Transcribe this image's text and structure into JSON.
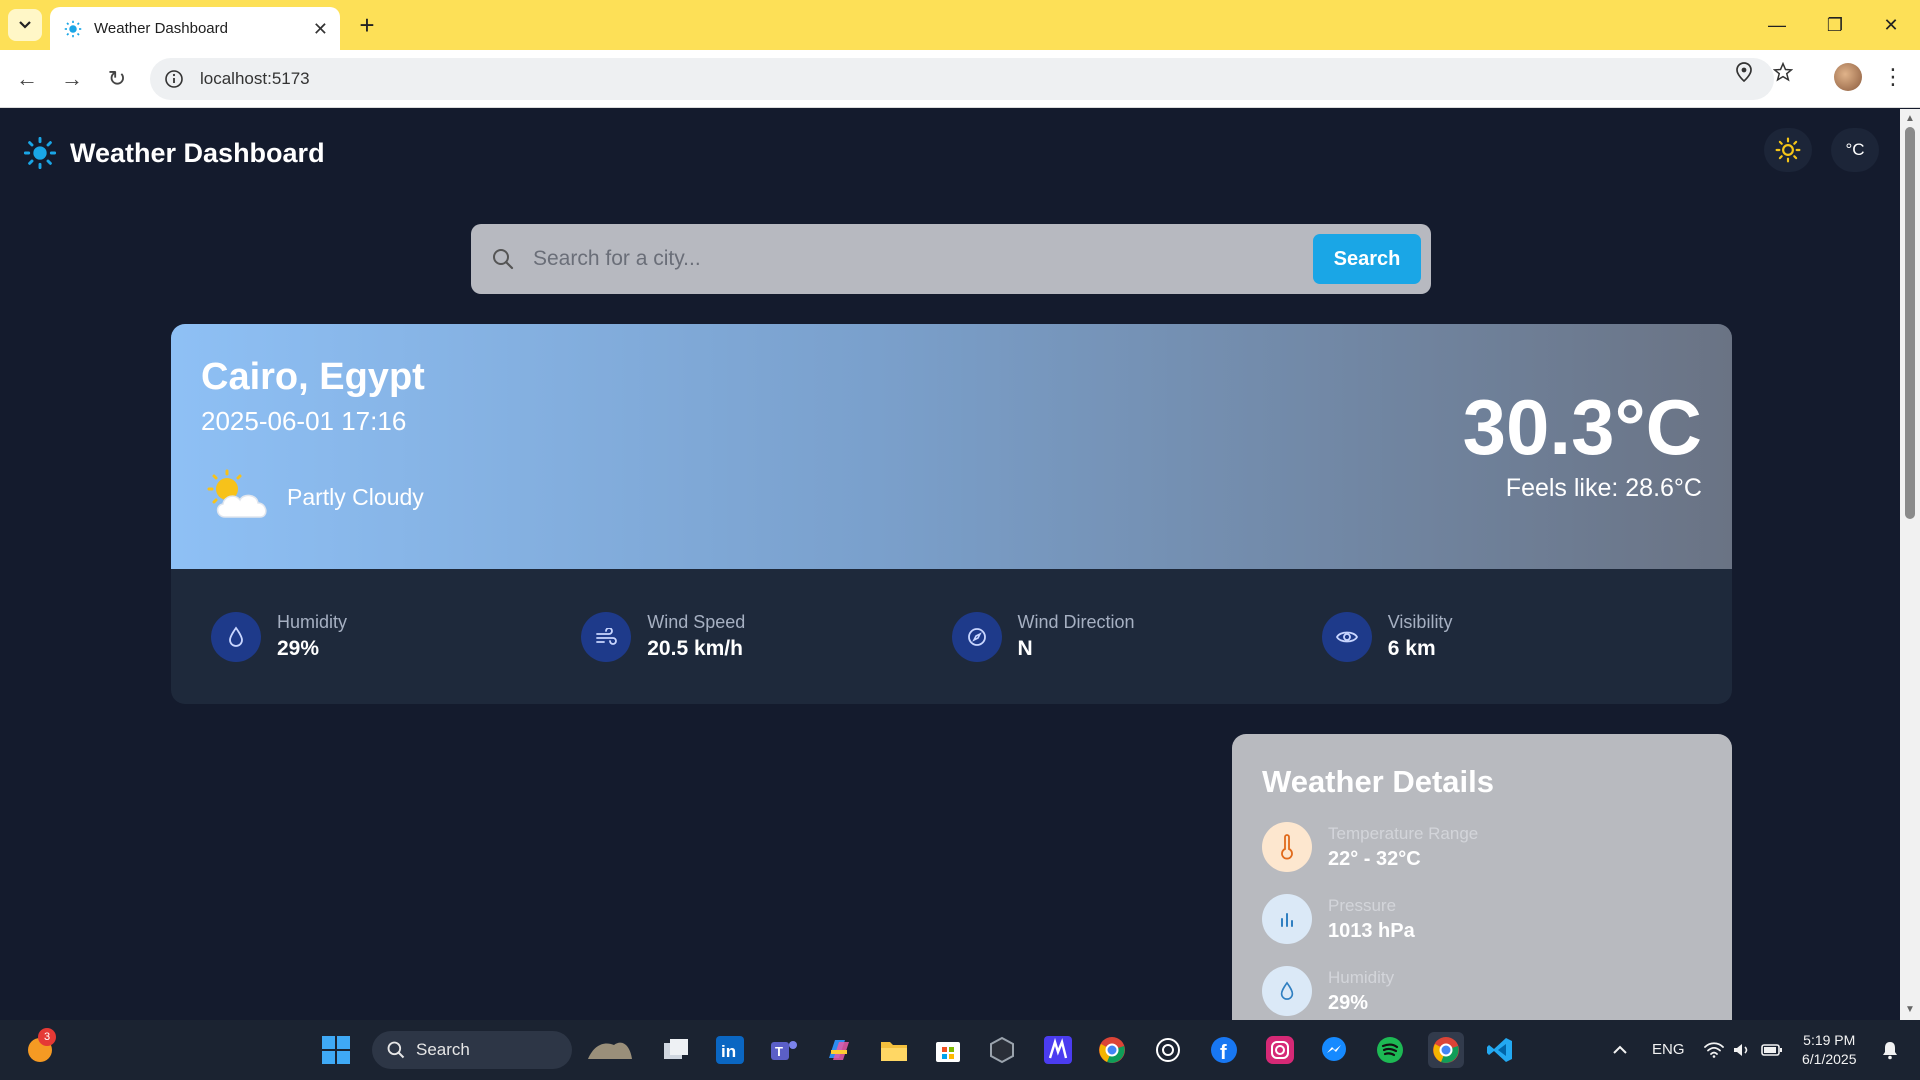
{
  "browser": {
    "tab_title": "Weather Dashboard",
    "url": "localhost:5173",
    "new_tab_label": "+"
  },
  "app": {
    "title": "Weather Dashboard",
    "unit_toggle": "°C"
  },
  "search": {
    "placeholder": "Search for a city...",
    "button_label": "Search"
  },
  "current": {
    "location": "Cairo, Egypt",
    "datetime": "2025-06-01 17:16",
    "condition": "Partly Cloudy",
    "temperature": "30.3°C",
    "feels_like": "Feels like: 28.6°C"
  },
  "stats": [
    {
      "label": "Humidity",
      "value": "29%",
      "icon": "droplet-icon"
    },
    {
      "label": "Wind Speed",
      "value": "20.5 km/h",
      "icon": "wind-icon"
    },
    {
      "label": "Wind Direction",
      "value": "N",
      "icon": "compass-icon"
    },
    {
      "label": "Visibility",
      "value": "6 km",
      "icon": "eye-icon"
    }
  ],
  "details": {
    "title": "Weather Details",
    "rows": [
      {
        "label": "Temperature Range",
        "value": "22° - 32°C",
        "icon": "thermometer-icon"
      },
      {
        "label": "Pressure",
        "value": "1013 hPa",
        "icon": "bar-chart-icon"
      },
      {
        "label": "Humidity",
        "value": "29%",
        "icon": "droplet-icon"
      }
    ]
  },
  "taskbar": {
    "search_label": "Search",
    "language": "ENG",
    "time": "5:19 PM",
    "date": "6/1/2025",
    "notification_count": "3"
  },
  "colors": {
    "page_bg": "#141b2d",
    "accent": "#1aa6e6",
    "browser_frame": "#fde057",
    "stat_icon_bg": "#1e3a8a"
  }
}
